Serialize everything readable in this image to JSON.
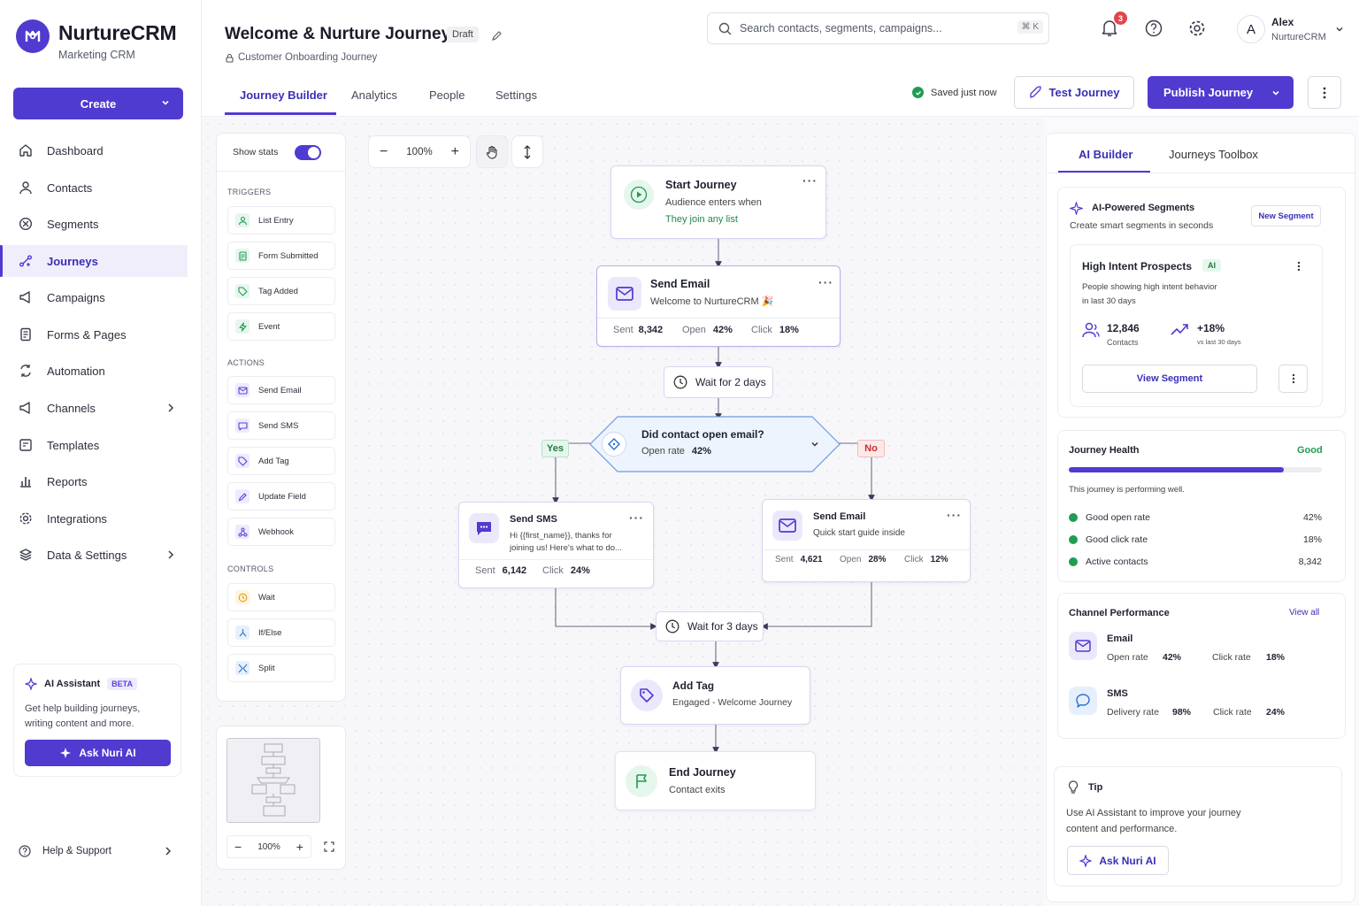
{
  "brand": {
    "name": "NurtureCRM",
    "sub": "Marketing CRM"
  },
  "sidebar": {
    "create_label": "Create",
    "items": [
      {
        "label": "Dashboard",
        "icon": "home-icon"
      },
      {
        "label": "Contacts",
        "icon": "user-icon"
      },
      {
        "label": "Segments",
        "icon": "segments-icon"
      },
      {
        "label": "Journeys",
        "icon": "journeys-icon",
        "active": true
      },
      {
        "label": "Campaigns",
        "icon": "megaphone-icon"
      },
      {
        "label": "Forms & Pages",
        "icon": "form-icon"
      },
      {
        "label": "Automation",
        "icon": "automation-icon"
      },
      {
        "label": "Channels",
        "icon": "channels-icon",
        "has_arrow": true
      },
      {
        "label": "Templates",
        "icon": "template-icon"
      },
      {
        "label": "Reports",
        "icon": "reports-icon"
      },
      {
        "label": "Integrations",
        "icon": "gear-icon"
      },
      {
        "label": "Data & Settings",
        "icon": "database-icon",
        "has_arrow": true
      }
    ],
    "ai_assistant": {
      "title": "AI Assistant",
      "badge": "BETA",
      "text_1": "Get help building journeys,",
      "text_2": "writing content and more.",
      "button": "Ask Nuri AI"
    },
    "help": "Help & Support"
  },
  "header": {
    "title": "Welcome & Nurture Journey",
    "status": "Draft",
    "subtitle": "Customer Onboarding Journey",
    "search_placeholder": "Search contacts, segments, campaigns...",
    "shortcut": "⌘ K",
    "notification_count": "3",
    "user": {
      "initial": "A",
      "name": "Alex",
      "org": "NurtureCRM"
    },
    "tabs": [
      "Journey Builder",
      "Analytics",
      "People",
      "Settings"
    ],
    "saved": "Saved just now",
    "test_button": "Test Journey",
    "publish_button": "Publish Journey"
  },
  "palette": {
    "show_stats": "Show stats",
    "show_stats_on": true,
    "triggers_title": "TRIGGERS",
    "triggers": [
      "List Entry",
      "Form Submitted",
      "Tag Added",
      "Event"
    ],
    "actions_title": "ACTIONS",
    "actions": [
      "Send Email",
      "Send SMS",
      "Add Tag",
      "Update Field",
      "Webhook"
    ],
    "controls_title": "CONTROLS",
    "controls": [
      "Wait",
      "If/Else",
      "Split"
    ]
  },
  "zoom": {
    "level": "100%",
    "minimap_level": "100%"
  },
  "flow": {
    "start": {
      "title": "Start Journey",
      "line1": "Audience enters when",
      "line2": "They join any list"
    },
    "email1": {
      "title": "Send Email",
      "subject": "Welcome to NurtureCRM 🎉",
      "sent_l": "Sent",
      "sent": "8,342",
      "open_l": "Open",
      "open": "42%",
      "click_l": "Click",
      "click": "18%"
    },
    "wait1": "Wait for 2 days",
    "condition": {
      "title": "Did contact open email?",
      "rate_l": "Open rate",
      "rate": "42%"
    },
    "yes": "Yes",
    "no": "No",
    "sms": {
      "title": "Send SMS",
      "line1": "Hi {{first_name}}, thanks for",
      "line2": "joining us! Here's what to do...",
      "sent_l": "Sent",
      "sent": "6,142",
      "click_l": "Click",
      "click": "24%"
    },
    "email2": {
      "title": "Send Email",
      "subject": "Quick start guide inside",
      "sent_l": "Sent",
      "sent": "4,621",
      "open_l": "Open",
      "open": "28%",
      "click_l": "Click",
      "click": "12%"
    },
    "wait2": "Wait for 3 days",
    "tag": {
      "title": "Add Tag",
      "sub": "Engaged - Welcome Journey"
    },
    "end": {
      "title": "End Journey",
      "sub": "Contact exits"
    }
  },
  "right": {
    "tabs": [
      "AI Builder",
      "Journeys Toolbox"
    ],
    "segments": {
      "title": "AI-Powered Segments",
      "sub": "Create smart segments in seconds",
      "new_btn": "New Segment",
      "card": {
        "title": "High Intent Prospects",
        "badge": "AI",
        "desc1": "People showing high intent behavior",
        "desc2": "in last 30 days",
        "contacts": "12,846",
        "contacts_l": "Contacts",
        "growth": "+18%",
        "growth_l": "vs last 30 days",
        "view_btn": "View Segment"
      }
    },
    "health": {
      "title": "Journey Health",
      "status": "Good",
      "progress": 0.85,
      "note": "This journey is performing well.",
      "rows": [
        {
          "label": "Good open rate",
          "value": "42%"
        },
        {
          "label": "Good click rate",
          "value": "18%"
        },
        {
          "label": "Active contacts",
          "value": "8,342"
        }
      ]
    },
    "channels": {
      "title": "Channel Performance",
      "view_all": "View all",
      "email": {
        "name": "Email",
        "m1_l": "Open rate",
        "m1": "42%",
        "m2_l": "Click rate",
        "m2": "18%"
      },
      "sms": {
        "name": "SMS",
        "m1_l": "Delivery rate",
        "m1": "98%",
        "m2_l": "Click rate",
        "m2": "24%"
      }
    },
    "tip": {
      "title": "Tip",
      "line1": "Use AI Assistant to improve your journey",
      "line2": "content and performance.",
      "button": "Ask Nuri AI"
    }
  },
  "colors": {
    "primary": "#4f3bd0",
    "success": "#1f9d55",
    "danger": "#d64545"
  }
}
